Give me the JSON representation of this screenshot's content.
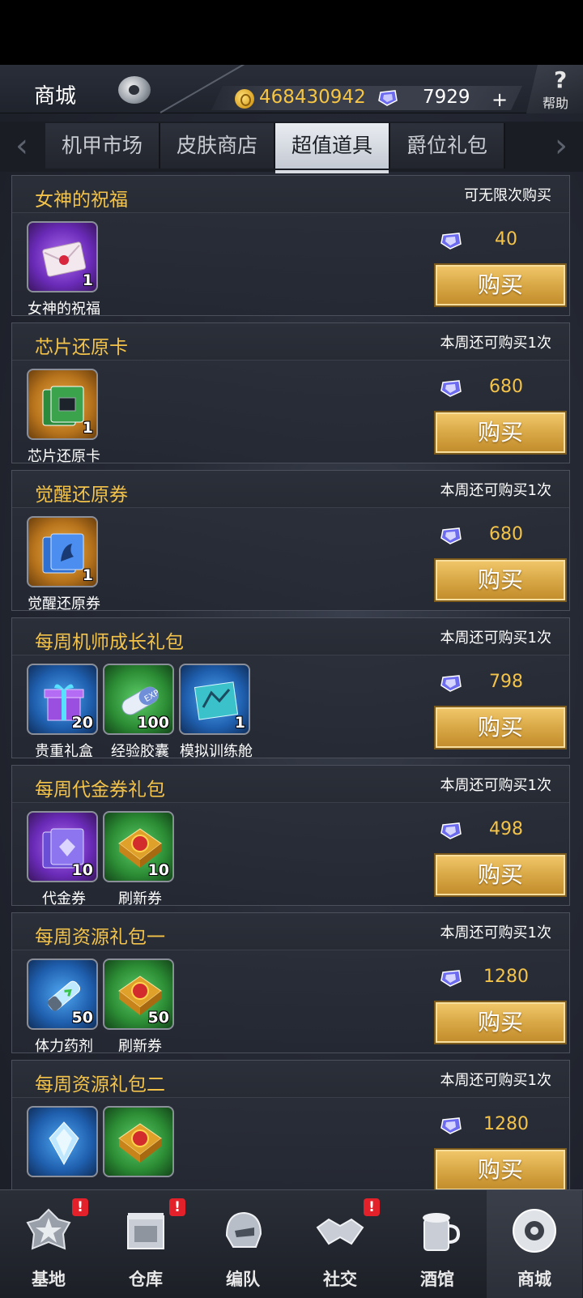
{
  "header": {
    "title": "商城",
    "coins": "468430942",
    "diamonds": "7929",
    "plus": "+",
    "help_label": "帮助",
    "help_symbol": "?"
  },
  "tabs": [
    {
      "label": "机甲市场"
    },
    {
      "label": "皮肤商店"
    },
    {
      "label": "超值道具",
      "active": true
    },
    {
      "label": "爵位礼包"
    }
  ],
  "tab_arrows": {
    "left": "‹",
    "right": "›"
  },
  "cards": [
    {
      "title": "女神的祝福",
      "limit": "可无限次购买",
      "price": "40",
      "buy": "购买",
      "items": [
        {
          "name": "女神的祝福",
          "qty": "1",
          "icon": "letter-icon",
          "bg": "purple"
        }
      ]
    },
    {
      "title": "芯片还原卡",
      "limit": "本周还可购买1次",
      "price": "680",
      "buy": "购买",
      "items": [
        {
          "name": "芯片还原卡",
          "qty": "1",
          "icon": "chip-card-icon",
          "bg": "gold"
        }
      ]
    },
    {
      "title": "觉醒还原券",
      "limit": "本周还可购买1次",
      "price": "680",
      "buy": "购买",
      "items": [
        {
          "name": "觉醒还原券",
          "qty": "1",
          "icon": "awaken-ticket-icon",
          "bg": "gold"
        }
      ]
    },
    {
      "title": "每周机师成长礼包",
      "limit": "本周还可购买1次",
      "price": "798",
      "buy": "购买",
      "items": [
        {
          "name": "贵重礼盒",
          "qty": "20",
          "icon": "gift-box-icon",
          "bg": "blue"
        },
        {
          "name": "经验胶囊",
          "qty": "100",
          "icon": "exp-capsule-icon",
          "bg": "green"
        },
        {
          "name": "模拟训练舱",
          "qty": "1",
          "icon": "training-pod-icon",
          "bg": "blue"
        }
      ]
    },
    {
      "title": "每周代金券礼包",
      "limit": "本周还可购买1次",
      "price": "498",
      "buy": "购买",
      "items": [
        {
          "name": "代金券",
          "qty": "10",
          "icon": "voucher-icon",
          "bg": "purple"
        },
        {
          "name": "刷新券",
          "qty": "10",
          "icon": "refresh-ticket-icon",
          "bg": "green"
        }
      ]
    },
    {
      "title": "每周资源礼包一",
      "limit": "本周还可购买1次",
      "price": "1280",
      "buy": "购买",
      "items": [
        {
          "name": "体力药剂",
          "qty": "50",
          "icon": "stamina-potion-icon",
          "bg": "blue"
        },
        {
          "name": "刷新券",
          "qty": "50",
          "icon": "refresh-ticket-icon",
          "bg": "green"
        }
      ]
    },
    {
      "title": "每周资源礼包二",
      "limit": "本周还可购买1次",
      "price": "1280",
      "buy": "购买",
      "items": [
        {
          "name": "",
          "qty": "",
          "icon": "crystal-icon",
          "bg": "blue"
        },
        {
          "name": "",
          "qty": "",
          "icon": "refresh-ticket-icon",
          "bg": "green"
        }
      ]
    }
  ],
  "nav": [
    {
      "label": "基地",
      "icon": "base-star-icon",
      "badge": "!"
    },
    {
      "label": "仓库",
      "icon": "warehouse-icon",
      "badge": "!"
    },
    {
      "label": "编队",
      "icon": "helmet-icon",
      "badge": ""
    },
    {
      "label": "社交",
      "icon": "handshake-icon",
      "badge": "!"
    },
    {
      "label": "酒馆",
      "icon": "tavern-icon",
      "badge": ""
    },
    {
      "label": "商城",
      "icon": "shop-orb-icon",
      "badge": "",
      "active": true
    }
  ],
  "colors": {
    "accent_gold": "#f3c34a",
    "buy_button": "#d9a846",
    "badge_red": "#e2212a"
  }
}
